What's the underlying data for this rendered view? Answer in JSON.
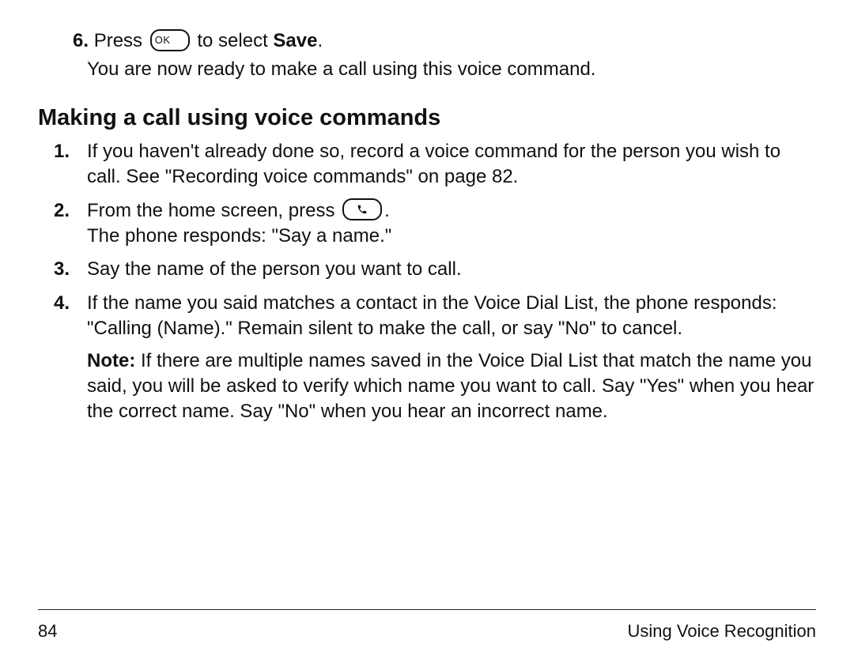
{
  "icons": {
    "ok_label": "OK"
  },
  "prior_step": {
    "number": "6.",
    "text_before": "Press ",
    "text_after": "  to select ",
    "select_bold": "Save",
    "period": ".",
    "subtext": "You are now ready to make a call using this voice command."
  },
  "heading": "Making a call using voice commands",
  "steps": [
    {
      "number": "1.",
      "body": "If you haven't already done so, record a voice command for the person you wish to call. See \"Recording voice commands\" on page 82."
    },
    {
      "number": "2.",
      "before_icon": "From the home screen, press ",
      "after_icon": ".",
      "line2": "The phone responds: \"Say a name.\""
    },
    {
      "number": "3.",
      "body": "Say the name of the person you want to call."
    },
    {
      "number": "4.",
      "body": "If the name you said matches a contact in the Voice Dial List, the phone responds: \"Calling (Name).\" Remain silent to make the call, or say \"No\" to cancel.",
      "note_label": "Note:",
      "note_body": " If there are multiple names saved in the Voice Dial List that match the name you said, you will be asked to verify which name you want to call. Say \"Yes\" when you hear the correct name. Say \"No\" when you hear an incorrect name."
    }
  ],
  "footer": {
    "page_number": "84",
    "section": "Using Voice Recognition"
  }
}
